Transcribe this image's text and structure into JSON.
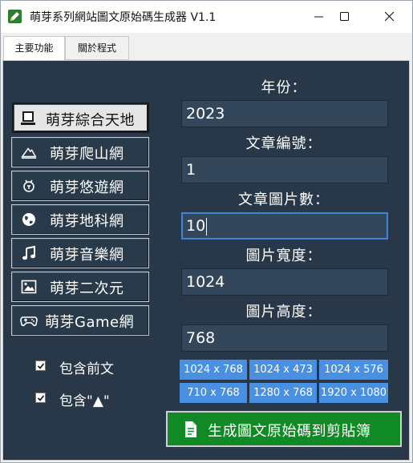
{
  "window": {
    "title": "萌芽系列網站圖文原始碼生成器 V1.1"
  },
  "tabs": [
    {
      "label": "主要功能",
      "active": true
    },
    {
      "label": "關於程式",
      "active": false
    }
  ],
  "sites": [
    {
      "label": "萌芽綜合天地",
      "icon": "computer-icon",
      "selected": true
    },
    {
      "label": "萌芽爬山網",
      "icon": "mountain-icon",
      "selected": false
    },
    {
      "label": "萌芽悠遊網",
      "icon": "travel-icon",
      "selected": false
    },
    {
      "label": "萌芽地科網",
      "icon": "globe-icon",
      "selected": false
    },
    {
      "label": "萌芽音樂網",
      "icon": "music-note-icon",
      "selected": false
    },
    {
      "label": "萌芽二次元",
      "icon": "anime-picture-icon",
      "selected": false
    },
    {
      "label": "萌芽Game網",
      "icon": "gamepad-icon",
      "selected": false
    }
  ],
  "form": {
    "year": {
      "label": "年份：",
      "value": "2023"
    },
    "article_id": {
      "label": "文章編號：",
      "value": "1"
    },
    "image_count": {
      "label": "文章圖片數：",
      "value": "10"
    },
    "image_width": {
      "label": "圖片寬度：",
      "value": "1024"
    },
    "image_height": {
      "label": "圖片高度：",
      "value": "768"
    }
  },
  "presets": [
    "1024 x 768",
    "1024 x 473",
    "1024 x 576",
    "710 x 768",
    "1280 x 768",
    "1920 x 1080"
  ],
  "options": [
    {
      "label": "包含前文",
      "checked": true
    },
    {
      "label": "包含\"▲\"",
      "checked": true
    }
  ],
  "generate_button": {
    "label": "生成圖文原始碼到剪貼簿"
  },
  "colors": {
    "panel_bg": "#283848",
    "field_bg": "#34475a",
    "preset_bg": "#4a90e2",
    "generate_bg": "#0f8a24"
  }
}
